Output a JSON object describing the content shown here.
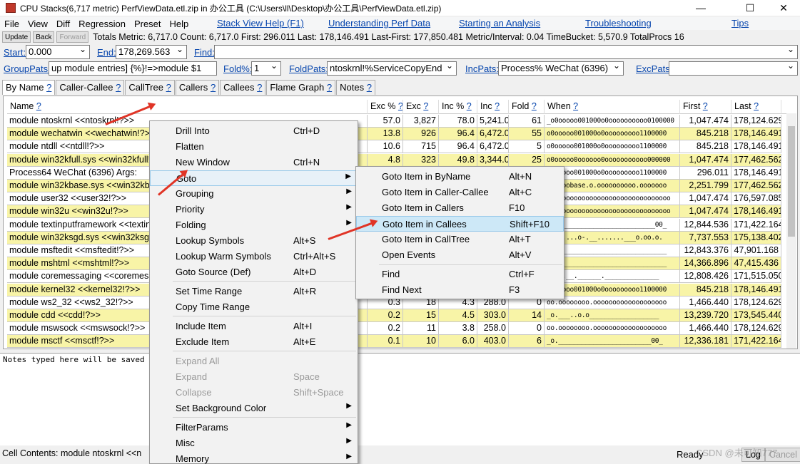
{
  "window": {
    "title": "CPU Stacks(6,717 metric) PerfViewData.etl.zip in 办公工具 (C:\\Users\\ll\\Desktop\\办公工具\\PerfViewData.etl.zip)",
    "controls": [
      "—",
      "☐",
      "✕"
    ]
  },
  "menubar": {
    "items": [
      "File",
      "View",
      "Diff",
      "Regression",
      "Preset",
      "Help"
    ],
    "links": [
      "Stack View Help (F1)",
      "Understanding Perf Data",
      "Starting an Analysis",
      "Troubleshooting",
      "Tips"
    ]
  },
  "toolbar": {
    "buttons": [
      "Update",
      "Back",
      "Forward"
    ],
    "metrics": "Totals Metric: 6,717.0  Count: 6,717.0  First: 296.011  Last: 178,146.491  Last-First: 177,850.481  Metric/Interval: 0.04  TimeBucket: 5,570.9  TotalProcs 16"
  },
  "range": {
    "start_label": "Start:",
    "start_value": "0.000",
    "end_label": "End:",
    "end_value": "178,269.563",
    "find_label": "Find:",
    "find_value": ""
  },
  "filters": {
    "grouppats_label": "GroupPats:",
    "grouppats_value": "up module entries]  {%}!=>module $1",
    "fold_label": "Fold%:",
    "fold_value": "1",
    "foldpats_label": "FoldPats:",
    "foldpats_value": "ntoskrnl!%ServiceCopyEnd",
    "incpats_label": "IncPats:",
    "incpats_value": "Process% WeChat (6396)",
    "excpats_label": "ExcPats:",
    "excpats_value": ""
  },
  "tabs": [
    "By Name",
    "Caller-Callee",
    "CallTree",
    "Callers",
    "Callees",
    "Flame Graph",
    "Notes"
  ],
  "grid": {
    "columns": [
      "Name",
      "Exc %",
      "Exc",
      "Inc %",
      "Inc",
      "Fold",
      "When",
      "First",
      "Last"
    ],
    "rows": [
      {
        "name": "module ntoskrnl <<ntoskrnl!?>>",
        "exc_pct": "57.0",
        "exc": "3,827",
        "inc_pct": "78.0",
        "inc": "5,241.0",
        "fold": "61",
        "when": "_o0ooooo001000o0oooooooooo0100000",
        "first": "1,047.474",
        "last": "178,124.629",
        "hl": false
      },
      {
        "name": "module wechatwin <<wechatwin!?>>",
        "exc_pct": "13.8",
        "exc": "926",
        "inc_pct": "96.4",
        "inc": "6,472.0",
        "fold": "55",
        "when": "o0ooooo001000o0ooooooooo1100000",
        "first": "845.218",
        "last": "178,146.491",
        "hl": true
      },
      {
        "name": "module ntdll <<ntdll!?>>",
        "exc_pct": "10.6",
        "exc": "715",
        "inc_pct": "96.4",
        "inc": "6,472.0",
        "fold": "5",
        "when": "o0ooooo001000o0ooooooooo1100000",
        "first": "845.218",
        "last": "178,146.491",
        "hl": false
      },
      {
        "name": "module win32kfull.sys <<win32kfull!?>>",
        "exc_pct": "4.8",
        "exc": "323",
        "inc_pct": "49.8",
        "inc": "3,344.0",
        "fold": "25",
        "when": "o0ooooo0oooooo0ooooooooooo000000",
        "first": "1,047.474",
        "last": "177,462.562",
        "hl": true
      },
      {
        "name": "Process64 WeChat (6396) Args:",
        "exc_pct": "",
        "exc": "",
        "inc_pct": "",
        "inc": "",
        "fold": "",
        "when": "o0ooooo001000o0ooooooooo1100000",
        "first": "296.011",
        "last": "178,146.491",
        "hl": false
      },
      {
        "name": "module win32kbase.sys <<win32kbase!?>>",
        "exc_pct": "",
        "exc": "",
        "inc_pct": "",
        "inc": "",
        "fold": "",
        "when": "oooooobase.o.oooooooooo.ooooooo",
        "first": "2,251.799",
        "last": "177,462.562",
        "hl": true
      },
      {
        "name": "module user32 <<user32!?>>",
        "exc_pct": "",
        "exc": "",
        "inc_pct": "",
        "inc": "",
        "fold": "",
        "when": "oooooooooooooooooooooooooooooooo",
        "first": "1,047.474",
        "last": "176,597.085",
        "hl": false
      },
      {
        "name": "module win32u <<win32u!?>>",
        "exc_pct": "",
        "exc": "",
        "inc_pct": "",
        "inc": "",
        "fold": "",
        "when": "oooooooooooooooooooooooooooooooo",
        "first": "1,047.474",
        "last": "178,146.491",
        "hl": true
      },
      {
        "name": "module textinputframework <<textinputframework!?>>",
        "exc_pct": "",
        "exc": "",
        "inc_pct": "",
        "inc": "",
        "fold": "",
        "when": "____________________________00_",
        "first": "12,844.536",
        "last": "171,422.164",
        "hl": false
      },
      {
        "name": "module win32ksgd.sys <<win32ksgd!?>>",
        "exc_pct": "",
        "exc": "",
        "inc_pct": "",
        "inc": "",
        "fold": "",
        "when": "___.....o-.__.......___o.oo.o.",
        "first": "7,737.553",
        "last": "175,138.402",
        "hl": true
      },
      {
        "name": "module msftedit <<msftedit!?>>",
        "exc_pct": "",
        "exc": "",
        "inc_pct": "",
        "inc": "",
        "fold": "",
        "when": "__oo___________________________",
        "first": "12,843.376",
        "last": "47,901.168",
        "hl": false
      },
      {
        "name": "module mshtml <<mshtml!?>>",
        "exc_pct": "",
        "exc": "",
        "inc_pct": "",
        "inc": "",
        "fold": "",
        "when": "__oo___________________________",
        "first": "14,366.896",
        "last": "47,415.436",
        "hl": true
      },
      {
        "name": "module coremessaging <<coremessaging!?>>",
        "exc_pct": "",
        "exc": "",
        "inc_pct": "",
        "inc": "",
        "fold": "",
        "when": "____.__.______.______________",
        "first": "12,808.426",
        "last": "171,515.050",
        "hl": false
      },
      {
        "name": "module kernel32 <<kernel32!?>>",
        "exc_pct": "",
        "exc": "",
        "inc_pct": "",
        "inc": "",
        "fold": "",
        "when": "o0ooooo001000o0ooooooooo1100000",
        "first": "845.218",
        "last": "178,146.491",
        "hl": true
      },
      {
        "name": "module ws2_32 <<ws2_32!?>>",
        "exc_pct": "0.3",
        "exc": "18",
        "inc_pct": "4.3",
        "inc": "288.0",
        "fold": "0",
        "when": "oo.oooooooo.ooooooooooooooooooo",
        "first": "1,466.440",
        "last": "178,124.629",
        "hl": false
      },
      {
        "name": "module cdd <<cdd!?>>",
        "exc_pct": "0.2",
        "exc": "15",
        "inc_pct": "4.5",
        "inc": "303.0",
        "fold": "14",
        "when": "_o.___..o.o__________________",
        "first": "13,239.720",
        "last": "173,545.440",
        "hl": true
      },
      {
        "name": "module mswsock <<mswsock!?>>",
        "exc_pct": "0.2",
        "exc": "11",
        "inc_pct": "3.8",
        "inc": "258.0",
        "fold": "0",
        "when": "oo.oooooooo.ooooooooooooooooooo",
        "first": "1,466.440",
        "last": "178,124.629",
        "hl": false
      },
      {
        "name": "module msctf <<msctf!?>>",
        "exc_pct": "0.1",
        "exc": "10",
        "inc_pct": "6.0",
        "inc": "403.0",
        "fold": "6",
        "when": "_o.________________________00_",
        "first": "12,336.181",
        "last": "171,422.164",
        "hl": true
      }
    ]
  },
  "notes": {
    "text": "Notes typed here will be saved"
  },
  "status": {
    "cell": "Cell Contents: module ntoskrnl <<n",
    "ready": "Ready",
    "log": "Log",
    "cancel": "Cancel"
  },
  "context_menu": {
    "items": [
      {
        "label": "Drill Into",
        "shortcut": "Ctrl+D"
      },
      {
        "label": "Flatten",
        "shortcut": ""
      },
      {
        "label": "New Window",
        "shortcut": "Ctrl+N"
      },
      {
        "label": "Goto",
        "shortcut": ""
      },
      {
        "label": "Grouping",
        "shortcut": ""
      },
      {
        "label": "Priority",
        "shortcut": ""
      },
      {
        "label": "Folding",
        "shortcut": ""
      },
      {
        "label": "Lookup Symbols",
        "shortcut": "Alt+S"
      },
      {
        "label": "Lookup Warm Symbols",
        "shortcut": "Ctrl+Alt+S"
      },
      {
        "label": "Goto Source (Def)",
        "shortcut": "Alt+D"
      },
      {
        "label": "Set Time Range",
        "shortcut": "Alt+R"
      },
      {
        "label": "Copy Time Range",
        "shortcut": ""
      },
      {
        "label": "Include Item",
        "shortcut": "Alt+I"
      },
      {
        "label": "Exclude Item",
        "shortcut": "Alt+E"
      },
      {
        "label": "Expand All",
        "shortcut": ""
      },
      {
        "label": "Expand",
        "shortcut": "Space"
      },
      {
        "label": "Collapse",
        "shortcut": "Shift+Space"
      },
      {
        "label": "Set Background Color",
        "shortcut": ""
      },
      {
        "label": "FilterParams",
        "shortcut": ""
      },
      {
        "label": "Misc",
        "shortcut": ""
      },
      {
        "label": "Memory",
        "shortcut": ""
      }
    ]
  },
  "submenu": {
    "items": [
      {
        "label": "Goto Item in ByName",
        "shortcut": "Alt+N"
      },
      {
        "label": "Goto Item in Caller-Callee",
        "shortcut": "Alt+C"
      },
      {
        "label": "Goto Item in Callers",
        "shortcut": "F10"
      },
      {
        "label": "Goto Item in Callees",
        "shortcut": "Shift+F10"
      },
      {
        "label": "Goto Item in CallTree",
        "shortcut": "Alt+T"
      },
      {
        "label": "Open Events",
        "shortcut": "Alt+V"
      },
      {
        "label": "Find",
        "shortcut": "Ctrl+F"
      },
      {
        "label": "Find Next",
        "shortcut": "F3"
      }
    ]
  },
  "watermark": "CSDN @未可知777",
  "colors": {
    "link": "#0645ad",
    "row_highlight": "#f8f4a7",
    "menu_highlight": "#cde8f7",
    "annotation_arrow": "#e03426"
  }
}
